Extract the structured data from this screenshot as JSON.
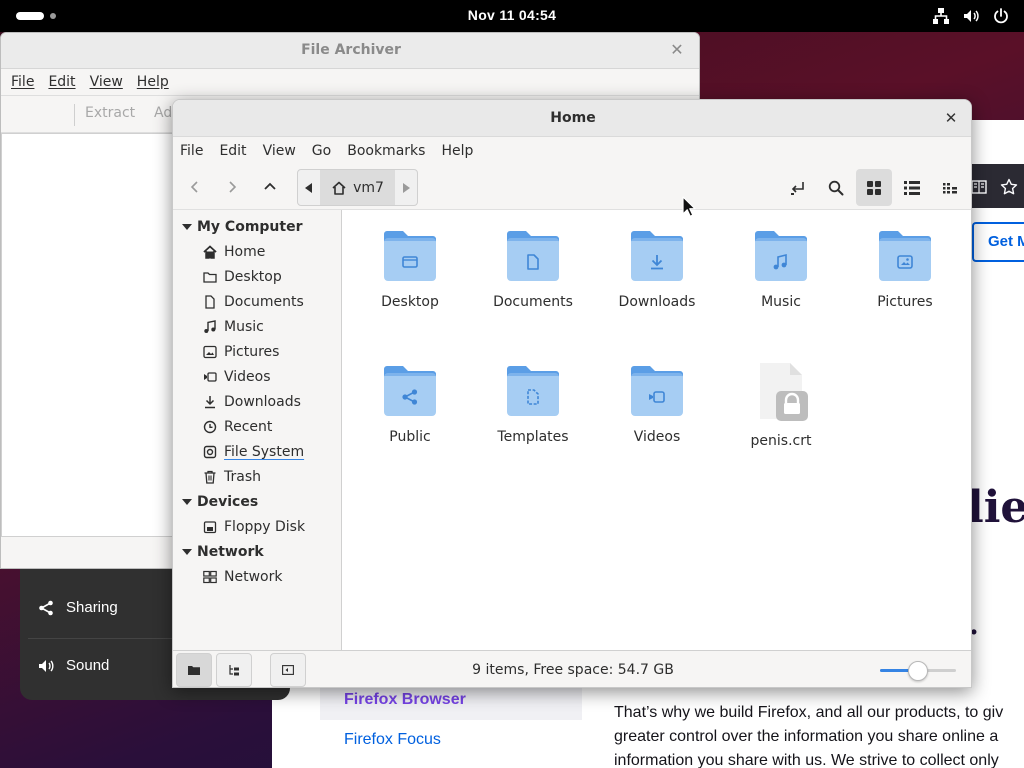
{
  "topbar": {
    "clock": "Nov 11  04:54"
  },
  "archiver": {
    "title": "File Archiver",
    "menu": [
      "File",
      "Edit",
      "View",
      "Help"
    ],
    "toolbar": {
      "extract": "Extract",
      "add": "Ad"
    }
  },
  "settings": {
    "items": [
      {
        "label": "Sharing",
        "icon": "share-icon"
      },
      {
        "label": "Sound",
        "icon": "speaker-icon"
      }
    ]
  },
  "firefox": {
    "get_button": "Get M",
    "headline": "liev",
    "dot": ".",
    "links": [
      "Firefox Browser",
      "Firefox Focus"
    ],
    "paragraph": [
      "That’s why we build Firefox, and all our products, to giv",
      "greater control over the information you share online a",
      "information you share with us. We strive to collect only"
    ]
  },
  "home": {
    "title": "Home",
    "menu": [
      "File",
      "Edit",
      "View",
      "Go",
      "Bookmarks",
      "Help"
    ],
    "path": {
      "crumb": "vm7"
    },
    "sidebar": {
      "sections": [
        {
          "header": "My Computer",
          "items": [
            {
              "label": "Home",
              "icon": "home-icon"
            },
            {
              "label": "Desktop",
              "icon": "folder-icon"
            },
            {
              "label": "Documents",
              "icon": "document-icon"
            },
            {
              "label": "Music",
              "icon": "music-icon"
            },
            {
              "label": "Pictures",
              "icon": "picture-icon"
            },
            {
              "label": "Videos",
              "icon": "video-icon"
            },
            {
              "label": "Downloads",
              "icon": "download-icon"
            },
            {
              "label": "Recent",
              "icon": "clock-icon"
            },
            {
              "label": "File System",
              "icon": "drive-icon"
            },
            {
              "label": "Trash",
              "icon": "trash-icon"
            }
          ]
        },
        {
          "header": "Devices",
          "items": [
            {
              "label": "Floppy Disk",
              "icon": "floppy-icon"
            }
          ]
        },
        {
          "header": "Network",
          "items": [
            {
              "label": "Network",
              "icon": "network-icon"
            }
          ]
        }
      ]
    },
    "files": [
      {
        "name": "Desktop",
        "emblem": "folder"
      },
      {
        "name": "Documents",
        "emblem": "document"
      },
      {
        "name": "Downloads",
        "emblem": "download"
      },
      {
        "name": "Music",
        "emblem": "music"
      },
      {
        "name": "Pictures",
        "emblem": "picture"
      },
      {
        "name": "Public",
        "emblem": "share"
      },
      {
        "name": "Templates",
        "emblem": "template"
      },
      {
        "name": "Videos",
        "emblem": "video"
      },
      {
        "name": "penis.crt",
        "emblem": "certificate"
      }
    ],
    "status": "9 items, Free space: 54.7 GB",
    "zoom_level": 0.5
  },
  "colors": {
    "folder_top": "#5b9ee6",
    "folder_body": "#a6cdf3",
    "emblem": "#3f86d6",
    "accent": "#3584e4"
  }
}
